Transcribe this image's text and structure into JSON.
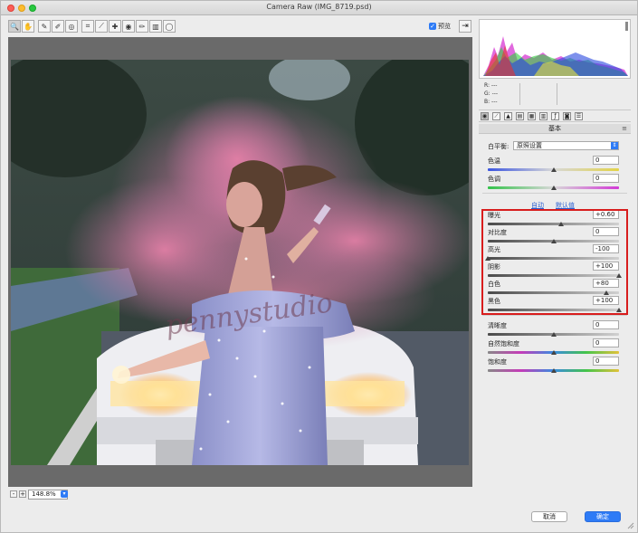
{
  "window": {
    "title": "Camera Raw (IMG_8719.psd)"
  },
  "toolbar": {
    "tools": [
      {
        "icon": "zoom-icon",
        "glyph": "🔍"
      },
      {
        "icon": "hand-icon",
        "glyph": "✋"
      },
      {
        "icon": "white-balance-icon",
        "glyph": "✎"
      },
      {
        "icon": "color-sampler-icon",
        "glyph": "✐"
      },
      {
        "icon": "target-adjust-icon",
        "glyph": "◎"
      },
      {
        "icon": "crop-icon",
        "glyph": "⌗"
      },
      {
        "icon": "straighten-icon",
        "glyph": "⟋"
      },
      {
        "icon": "spot-removal-icon",
        "glyph": "✚"
      },
      {
        "icon": "red-eye-icon",
        "glyph": "◉"
      },
      {
        "icon": "brush-icon",
        "glyph": "✏"
      },
      {
        "icon": "graduated-filter-icon",
        "glyph": "▥"
      },
      {
        "icon": "radial-filter-icon",
        "glyph": "◯"
      }
    ],
    "preview_label": "预览",
    "preview_checked": true
  },
  "zoom": {
    "minus": "-",
    "plus": "+",
    "value": "148.8%"
  },
  "rgb": {
    "r": "R:  ---",
    "g": "G:  ---",
    "b": "B:  ---"
  },
  "panel": {
    "title": "基本",
    "menu_icon": "≡",
    "white_balance_label": "白平衡:",
    "white_balance_value": "原照设置",
    "auto_label": "自动",
    "default_label": "默认值",
    "sliders_top": [
      {
        "label": "色温",
        "value": "0",
        "level": 0.5
      },
      {
        "label": "色调",
        "value": "0",
        "level": 0.5
      }
    ],
    "sliders_tone": [
      {
        "label": "曝光",
        "value": "+0.60",
        "level": 0.56
      },
      {
        "label": "对比度",
        "value": "0",
        "level": 0.5
      },
      {
        "label": "高光",
        "value": "-100",
        "level": 0.0
      },
      {
        "label": "阴影",
        "value": "+100",
        "level": 1.0
      },
      {
        "label": "白色",
        "value": "+80",
        "level": 0.9
      },
      {
        "label": "黑色",
        "value": "+100",
        "level": 1.0
      }
    ],
    "sliders_presence": [
      {
        "label": "清晰度",
        "value": "0",
        "level": 0.5
      },
      {
        "label": "自然饱和度",
        "value": "0",
        "level": 0.5
      },
      {
        "label": "饱和度",
        "value": "0",
        "level": 0.5
      }
    ]
  },
  "buttons": {
    "cancel": "取消",
    "ok": "确定"
  },
  "colors": {
    "accent": "#2e7bf6",
    "highlight_border": "#d81d1d"
  }
}
